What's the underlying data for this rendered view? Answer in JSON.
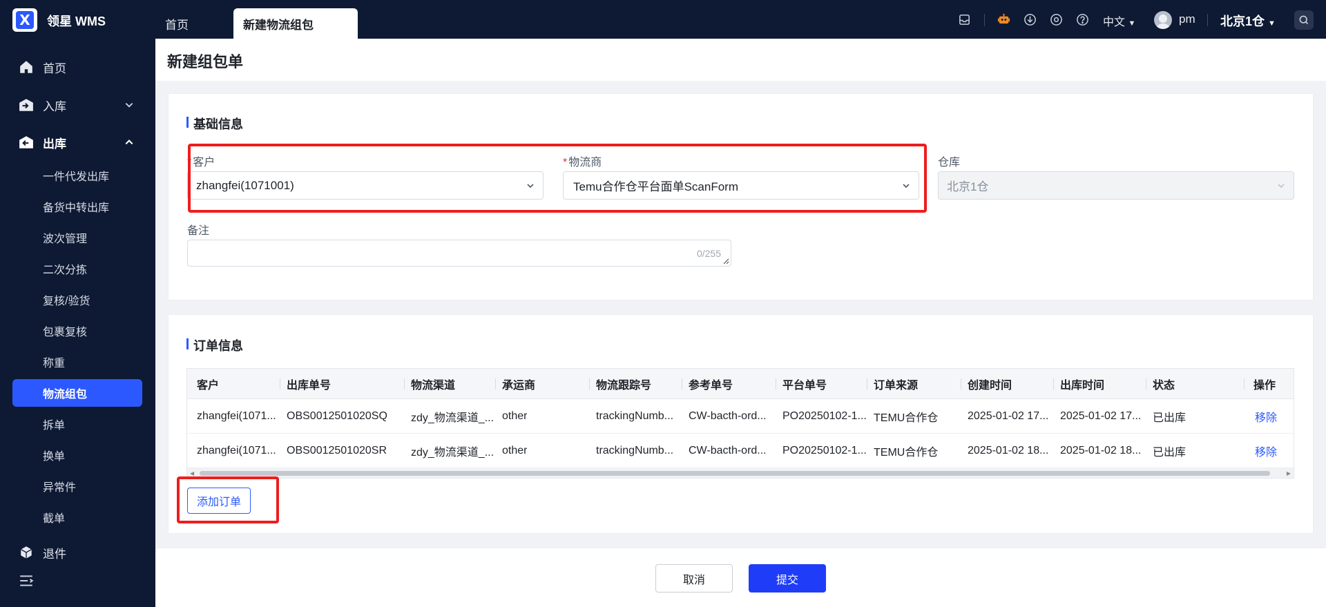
{
  "app": {
    "brand": "领星 WMS",
    "logo_letter": "X"
  },
  "tabs": [
    {
      "label": "首页"
    },
    {
      "label": "新建物流组包"
    }
  ],
  "topbar": {
    "language": "中文",
    "user": "pm",
    "warehouse": "北京1仓",
    "icons": [
      "inbox-icon",
      "robot-icon",
      "download-icon",
      "settings-icon",
      "help-icon",
      "search-icon"
    ]
  },
  "sidebar": {
    "items": [
      {
        "label": "首页",
        "icon": "home-icon"
      },
      {
        "label": "入库",
        "icon": "inbound-icon"
      },
      {
        "label": "出库",
        "icon": "outbound-icon"
      },
      {
        "label": "退件",
        "icon": "return-icon"
      }
    ],
    "outbound_sub": [
      "一件代发出库",
      "备货中转出库",
      "波次管理",
      "二次分拣",
      "复核/验货",
      "包裹复核",
      "称重",
      "物流组包",
      "拆单",
      "换单",
      "异常件",
      "截单"
    ]
  },
  "page": {
    "title": "新建组包单"
  },
  "basic": {
    "title": "基础信息",
    "customer_label": "客户",
    "customer_value": "zhangfei(1071001)",
    "carrier_label": "物流商",
    "carrier_value": "Temu合作仓平台面单ScanForm",
    "warehouse_label": "仓库",
    "warehouse_value": "北京1仓",
    "remark_label": "备注",
    "remark_counter": "0/255"
  },
  "orders": {
    "title": "订单信息",
    "columns": [
      "客户",
      "出库单号",
      "物流渠道",
      "承运商",
      "物流跟踪号",
      "参考单号",
      "平台单号",
      "订单来源",
      "创建时间",
      "出库时间",
      "状态",
      "操作"
    ],
    "rows": [
      [
        "zhangfei(1071...",
        "OBS0012501020SQ",
        "zdy_物流渠道_...",
        "other",
        "trackingNumb...",
        "CW-bacth-ord...",
        "PO20250102-1...",
        "TEMU合作仓",
        "2025-01-02 17...",
        "2025-01-02 17...",
        "已出库",
        "移除"
      ],
      [
        "zhangfei(1071...",
        "OBS0012501020SR",
        "zdy_物流渠道_...",
        "other",
        "trackingNumb...",
        "CW-bacth-ord...",
        "PO20250102-1...",
        "TEMU合作仓",
        "2025-01-02 18...",
        "2025-01-02 18...",
        "已出库",
        "移除"
      ]
    ],
    "add_button": "添加订单"
  },
  "footer": {
    "cancel": "取消",
    "submit": "提交"
  },
  "colors": {
    "primary": "#2b59ff",
    "sidebar_bg": "#0e1a33",
    "highlight_box": "#ee1d1d"
  }
}
